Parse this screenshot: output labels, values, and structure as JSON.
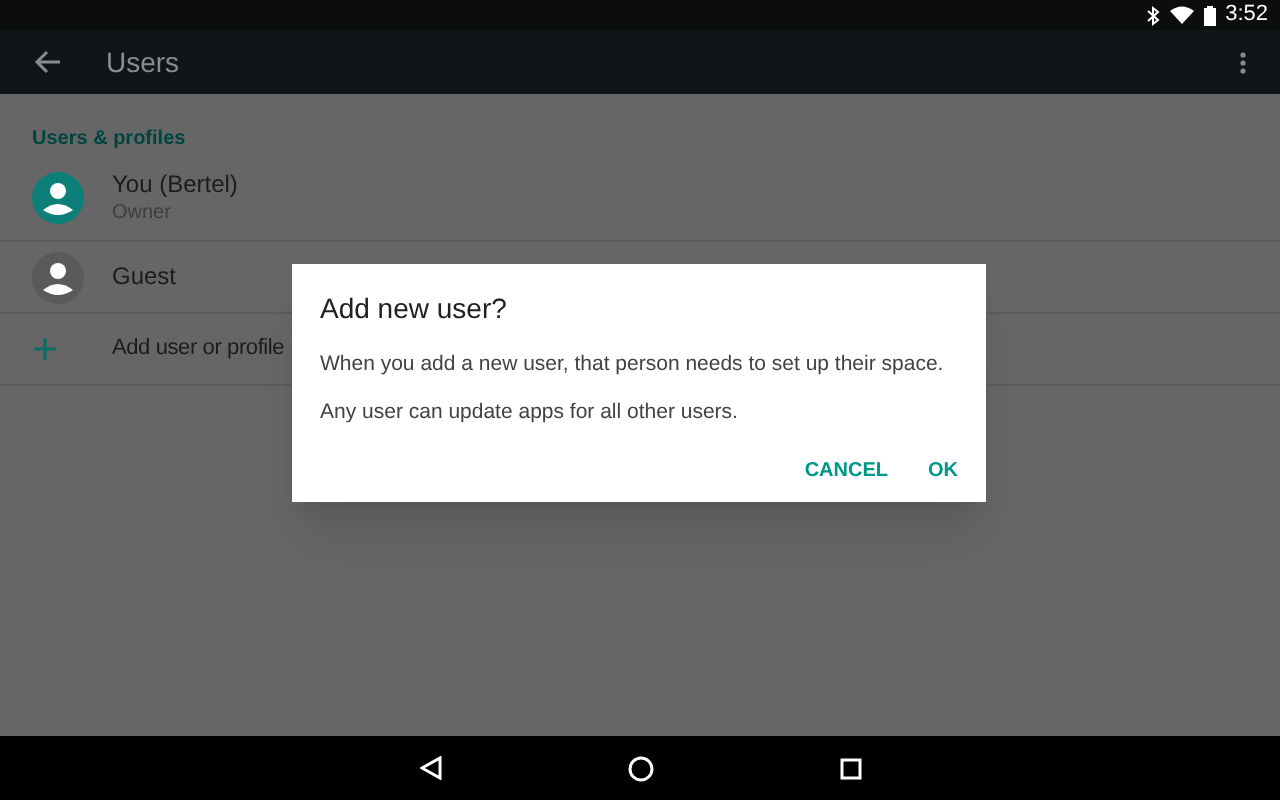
{
  "status_bar": {
    "time": "3:52"
  },
  "toolbar": {
    "title": "Users"
  },
  "section": {
    "title": "Users & profiles"
  },
  "items": [
    {
      "kind": "user",
      "title": "You (Bertel)",
      "subtitle": "Owner",
      "color": "#0b7f78"
    },
    {
      "kind": "user",
      "title": "Guest",
      "color": "#5a5a5a"
    }
  ],
  "add_item": {
    "title": "Add user or profile"
  },
  "dialog": {
    "title": "Add new user?",
    "messages": [
      "When you add a new user, that person needs to set up their space.",
      "Any user can update apps for all other users."
    ],
    "buttons": [
      "CANCEL",
      "OK"
    ]
  }
}
